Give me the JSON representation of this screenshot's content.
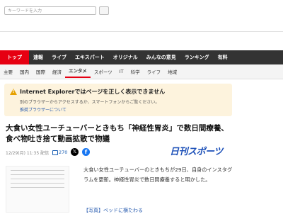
{
  "search": {
    "placeholder": "キーワードを入力"
  },
  "nav_primary": [
    {
      "label": "トップ",
      "active": true
    },
    {
      "label": "速報"
    },
    {
      "label": "ライブ"
    },
    {
      "label": "エキスパート"
    },
    {
      "label": "オリジナル"
    },
    {
      "label": "みんなの意見"
    },
    {
      "label": "ランキング"
    },
    {
      "label": "有料"
    }
  ],
  "nav_secondary": [
    {
      "label": "主要"
    },
    {
      "label": "国内"
    },
    {
      "label": "国際"
    },
    {
      "label": "経済"
    },
    {
      "label": "エンタメ",
      "active": true
    },
    {
      "label": "スポーツ"
    },
    {
      "label": "IT"
    },
    {
      "label": "科学"
    },
    {
      "label": "ライフ"
    },
    {
      "label": "地域"
    }
  ],
  "notice": {
    "title": "Internet Explorerではページを正しく表示できません",
    "subtitle": "別のブラウザーからアクセスするか、スマートフォンからご覧ください。",
    "link": "推奨ブラウザーについて"
  },
  "article": {
    "headline": "大食い女性ユーチューバーときもち「神経性胃炎」で数日間療養、食べ物吐き捨て動画拡散で物議",
    "meta": "12/29(月) 11:35 配信",
    "comments": "270",
    "source_logo": "日刊スポーツ",
    "body": "大食い女性ユーチューバーのときもちが29日、自身のインスタグラムを更新。神経性胃炎で数日間療養すると明かした。",
    "photo_link": "【写真】ベッドに横たわる"
  },
  "colors": {
    "accent": "#e60012",
    "nav_bg": "#333333",
    "notice_bg": "#fdf3dd",
    "logo": "#1b4fb8"
  }
}
